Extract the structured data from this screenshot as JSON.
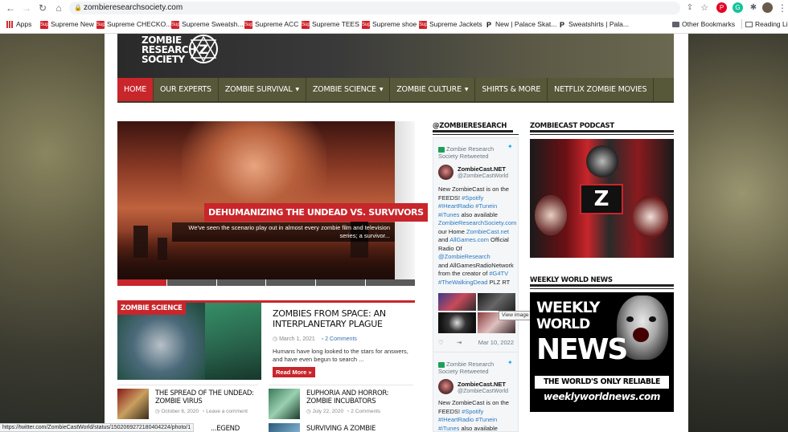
{
  "browser": {
    "url": "zombieresearchsociety.com",
    "bookmarks": [
      {
        "label": "Apps"
      },
      {
        "label": "Supreme New",
        "fav": "Sup"
      },
      {
        "label": "Supreme CHECKO...",
        "fav": "Sup"
      },
      {
        "label": "Supreme Sweatsh...",
        "fav": "Sup"
      },
      {
        "label": "Supreme ACC",
        "fav": "Sup"
      },
      {
        "label": "Supreme TEES",
        "fav": "Sup"
      },
      {
        "label": "Supreme shoe",
        "fav": "Sup"
      },
      {
        "label": "Supreme Jackets",
        "fav": "Sup"
      },
      {
        "label": "New | Palace Skat...",
        "fav": "P"
      },
      {
        "label": "Sweatshirts | Pala...",
        "fav": "P"
      }
    ],
    "other_bookmarks": "Other Bookmarks",
    "reading_list": "Reading List",
    "status_url": "https://twitter.com/ZombieCastWorld/status/1502069272180404224/photo/1"
  },
  "site": {
    "logo_line1": "ZOMBIE",
    "logo_line2": "RESEARCH",
    "logo_line3": "SOCIETY",
    "logo_mark": "Z"
  },
  "nav": [
    {
      "label": "HOME",
      "active": true,
      "dropdown": false
    },
    {
      "label": "OUR EXPERTS",
      "dropdown": false
    },
    {
      "label": "ZOMBIE SURVIVAL",
      "dropdown": true
    },
    {
      "label": "ZOMBIE SCIENCE",
      "dropdown": true
    },
    {
      "label": "ZOMBIE CULTURE",
      "dropdown": true
    },
    {
      "label": "SHIRTS & MORE",
      "dropdown": false
    },
    {
      "label": "NETFLIX ZOMBIE MOVIES",
      "dropdown": false
    }
  ],
  "slider": {
    "title": "DEHUMANIZING THE UNDEAD VS. SURVIVORS",
    "excerpt": "We've seen the scenario play out in almost every zombie film and television series; a survivor..."
  },
  "category": {
    "badge": "ZOMBIE SCIENCE",
    "feature": {
      "title": "ZOMBIES FROM SPACE: AN INTERPLANETARY PLAGUE",
      "date": "March 1, 2021",
      "comments": "2 Comments",
      "excerpt": "Humans have long looked to the stars for answers, and have even begun to search ...",
      "read_more": "Read More »"
    },
    "posts": [
      {
        "title": "THE SPREAD OF THE UNDEAD: ZOMBIE VIRUS",
        "date": "October 6, 2020",
        "comments": "Leave a comment"
      },
      {
        "title": "EUPHORIA AND HORROR: ZOMBIE INCUBATORS",
        "date": "July 22, 2020",
        "comments": "2 Comments"
      },
      {
        "title": "...EGEND"
      },
      {
        "title": "SURVIVING A ZOMBIE"
      }
    ]
  },
  "twitter": {
    "heading": "@ZOMBIERESEARCH",
    "retweeted": "Zombie Research Society Retweeted",
    "name": "ZombieCast.NET",
    "handle": "@ZombieCastWorld",
    "t1_line1": "New ZombieCast is on the",
    "t1_line2a": "FEEDS! ",
    "t1_spotify": "#Spotify",
    "t1_iheart": "#IHeartRadio",
    "t1_tunein": "#Tunein",
    "t1_itunes": "#iTunes",
    "t1_also": " also available",
    "t1_zrs": "ZombieResearchSociety.com",
    "t1_our": "our Home ",
    "t1_zcn": "ZombieCast.net",
    "t1_and": "and ",
    "t1_allgames": "AllGames.com",
    "t1_official": " Official",
    "t1_radio": "Radio Of ",
    "t1_at": "@ZombieResearch",
    "t1_network": "and AllGamesRadioNetwork",
    "t1_creator": "from the creator of ",
    "t1_g4tv": "#G4TV",
    "t1_twd": "#TheWalkingDead",
    "t1_plz": "  PLZ RT",
    "date": "Mar 10, 2022",
    "tooltip": "View image on Twitter"
  },
  "right": {
    "podcast_heading": "ZOMBIECAST PODCAST",
    "podcast_mark": "Z",
    "wwn_heading": "WEEKLY WORLD NEWS",
    "wwn_line1": "WEEKLY",
    "wwn_line2": "WORLD",
    "wwn_line3": "NEWS",
    "wwn_tagline": "THE WORLD'S ONLY RELIABLE NEWS",
    "wwn_site": "weeklyworldnews.com"
  },
  "colors": {
    "accent": "#c8262b",
    "nav_bg": "#575739"
  }
}
